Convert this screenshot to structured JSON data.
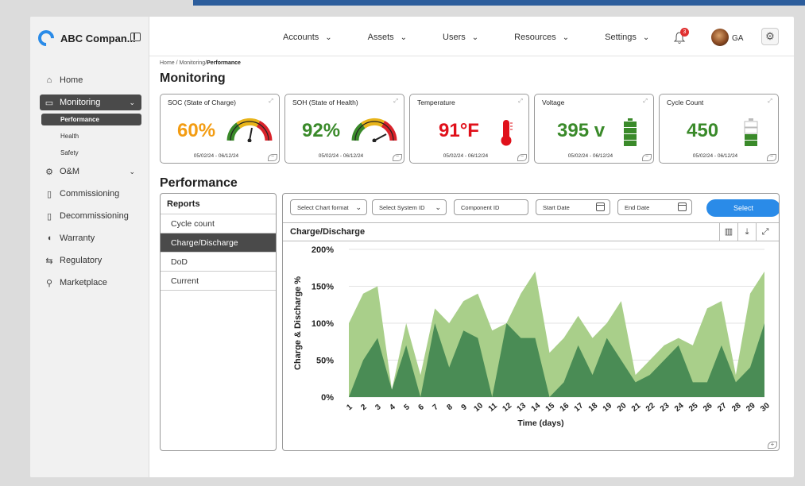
{
  "app": {
    "brand": "ABC Compan...",
    "menu": [
      {
        "label": "Accounts"
      },
      {
        "label": "Assets"
      },
      {
        "label": "Users"
      },
      {
        "label": "Resources"
      },
      {
        "label": "Settings"
      }
    ],
    "notifications": "3",
    "user_initials": "GA"
  },
  "sidebar": {
    "items": [
      {
        "label": "Home",
        "icon": "home-icon"
      },
      {
        "label": "Monitoring",
        "icon": "monitor-icon"
      },
      {
        "label": "O&M",
        "icon": "gears-icon"
      },
      {
        "label": "Commissioning",
        "icon": "battery-icon"
      },
      {
        "label": "Decommissioning",
        "icon": "battery-empty-icon"
      },
      {
        "label": "Warranty",
        "icon": "shield-icon"
      },
      {
        "label": "Regulatory",
        "icon": "regulatory-icon"
      },
      {
        "label": "Marketplace",
        "icon": "marketplace-icon"
      }
    ],
    "monitoring_sub": [
      "Performance",
      "Health",
      "Safety"
    ]
  },
  "breadcrumb": {
    "path": "Home / Monitoring/",
    "current": "Performance"
  },
  "page_title": "Monitoring",
  "cards": [
    {
      "title": "SOC (State of Charge)",
      "value": "60%",
      "color": "#f39c12",
      "date": "05/02/24 - 06/12/24",
      "visual": "gauge"
    },
    {
      "title": "SOH (State of Health)",
      "value": "92%",
      "color": "#3a8a2a",
      "date": "05/02/24 - 06/12/24",
      "visual": "gauge"
    },
    {
      "title": "Temperature",
      "value": "91°F",
      "color": "#e0101a",
      "date": "05/02/24 - 06/12/24",
      "visual": "thermometer"
    },
    {
      "title": "Voltage",
      "value": "395 v",
      "color": "#3a8a2a",
      "date": "05/02/24 - 06/12/24",
      "visual": "battery-full"
    },
    {
      "title": "Cycle Count",
      "value": "450",
      "color": "#3a8a2a",
      "date": "05/02/24 - 06/12/24",
      "visual": "battery-partial"
    }
  ],
  "performance": {
    "title": "Performance",
    "reports_title": "Reports",
    "reports": [
      "Cycle count",
      "Charge/Discharge",
      "DoD",
      "Current"
    ],
    "filters": {
      "chart_format": "Select Chart format",
      "system_id": "Select System ID",
      "component_id": "Component ID",
      "start_date": "Start Date",
      "end_date": "End Date",
      "select_button": "Select"
    },
    "chart_title": "Charge/Discharge"
  },
  "chart_data": {
    "type": "area",
    "xlabel": "Time (days)",
    "ylabel": "Charge & Discharge %",
    "x": [
      1,
      2,
      3,
      4,
      5,
      6,
      7,
      8,
      9,
      10,
      11,
      12,
      13,
      14,
      15,
      16,
      17,
      18,
      19,
      20,
      21,
      22,
      23,
      24,
      25,
      26,
      27,
      28,
      29,
      30
    ],
    "ylim": [
      0,
      200
    ],
    "yticks": [
      "0%",
      "50%",
      "100%",
      "150%",
      "200%"
    ],
    "series": [
      {
        "color": "#a9cf8a",
        "values": [
          100,
          140,
          150,
          10,
          100,
          30,
          120,
          100,
          130,
          140,
          90,
          100,
          140,
          170,
          60,
          80,
          110,
          80,
          100,
          130,
          30,
          50,
          70,
          80,
          70,
          120,
          130,
          30,
          140,
          170
        ]
      },
      {
        "color": "#4a8c55",
        "values": [
          0,
          50,
          80,
          10,
          70,
          0,
          100,
          40,
          90,
          80,
          0,
          100,
          80,
          80,
          0,
          20,
          70,
          30,
          80,
          50,
          20,
          30,
          50,
          70,
          20,
          20,
          70,
          20,
          40,
          100
        ]
      }
    ],
    "grid": true
  }
}
